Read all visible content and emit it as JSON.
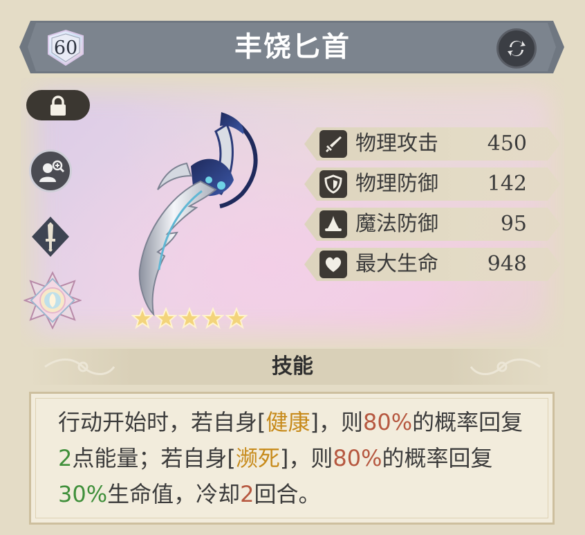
{
  "header": {
    "level": "60",
    "title": "丰饶匕首"
  },
  "weapon": {
    "stars": 5
  },
  "stats": [
    {
      "icon": "sword-icon",
      "label": "物理攻击",
      "value": "450"
    },
    {
      "icon": "shield-icon",
      "label": "物理防御",
      "value": "142"
    },
    {
      "icon": "wizard-hat-icon",
      "label": "魔法防御",
      "value": "95"
    },
    {
      "icon": "heart-icon",
      "label": "最大生命",
      "value": "948"
    }
  ],
  "skill": {
    "title": "技能",
    "description": {
      "p1": "行动开始时，若自身[",
      "state1": "健康",
      "p2": "]，则",
      "chance1": "80%",
      "p3": "的概率回复",
      "energy": "2",
      "p4": "点能量；若自身[",
      "state2": "濒死",
      "p5": "]，则",
      "chance2": "80%",
      "p6": "的概率回复",
      "heal": "30%",
      "p7": "生命值，冷却",
      "cooldown": "2",
      "p8": "回合。"
    }
  },
  "colors": {
    "banner": "#7c848e",
    "highlight_gold": "#c78a1a",
    "highlight_red": "#b65840",
    "highlight_green": "#3f8f3a"
  }
}
